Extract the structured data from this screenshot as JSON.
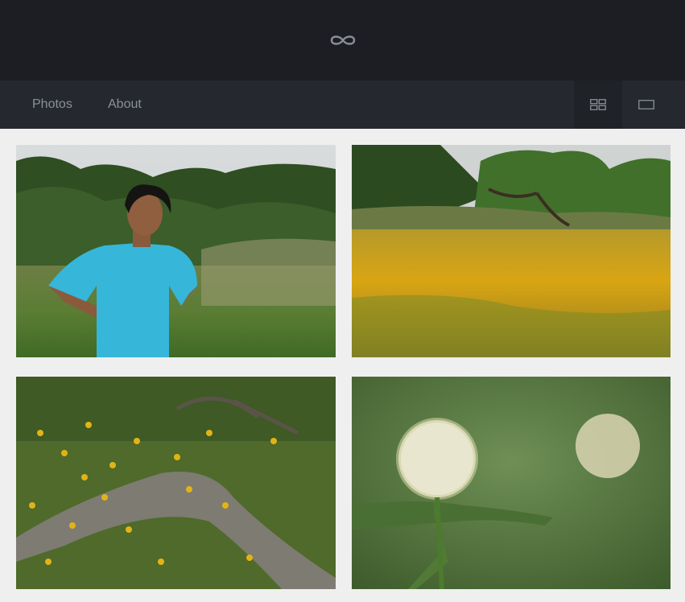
{
  "header": {
    "logo_icon": "infinity-icon"
  },
  "nav": {
    "links": [
      {
        "label": "Photos"
      },
      {
        "label": "About"
      }
    ],
    "view_toggles": [
      {
        "icon": "grid-view-icon",
        "active": true
      },
      {
        "icon": "single-view-icon",
        "active": false
      }
    ]
  },
  "gallery": {
    "photos": [
      {
        "subject": "person-in-blue-shirt-in-field"
      },
      {
        "subject": "yellow-wildflower-meadow"
      },
      {
        "subject": "wildflowers-and-fallen-log"
      },
      {
        "subject": "milkweed-blossoms"
      }
    ]
  },
  "colors": {
    "topbar": "#1c1e23",
    "navbar": "#25282e",
    "nav_text": "#8b909a",
    "page_bg": "#efefef"
  }
}
